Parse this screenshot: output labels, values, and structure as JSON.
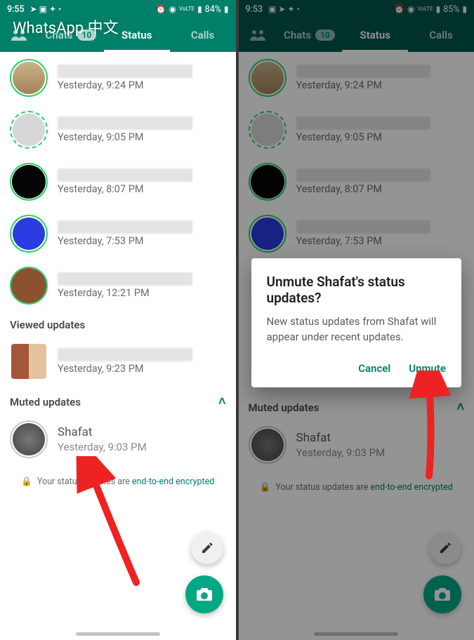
{
  "watermark": "WhatsApp 中文",
  "left": {
    "statusbar": {
      "time": "9:55",
      "battery": "84%"
    },
    "tabs": {
      "chats": "Chats",
      "chats_badge": "10",
      "status": "Status",
      "calls": "Calls"
    },
    "statuses": [
      {
        "time": "Yesterday, 9:24 PM",
        "ring": "green",
        "avatar": "bag"
      },
      {
        "time": "Yesterday, 9:05 PM",
        "ring": "dash",
        "avatar": "grey"
      },
      {
        "time": "Yesterday, 8:07 PM",
        "ring": "green",
        "avatar": "black"
      },
      {
        "time": "Yesterday, 7:53 PM",
        "ring": "green",
        "avatar": "blue"
      },
      {
        "time": "Yesterday, 12:21 PM",
        "ring": "green",
        "avatar": "brown"
      }
    ],
    "sections": {
      "viewed": "Viewed updates",
      "viewed_item_time": "Yesterday, 9:23 PM",
      "muted": "Muted updates",
      "muted_item": {
        "name": "Shafat",
        "time": "Yesterday, 9:03 PM"
      }
    },
    "encryption": {
      "prefix": "Your status updates are ",
      "link": "end-to-end encrypted"
    }
  },
  "right": {
    "statusbar": {
      "time": "9:53",
      "battery": "85%"
    },
    "dialog": {
      "title": "Unmute Shafat's status updates?",
      "body": "New status updates from Shafat will appear under recent updates.",
      "cancel": "Cancel",
      "confirm": "Unmute"
    }
  }
}
